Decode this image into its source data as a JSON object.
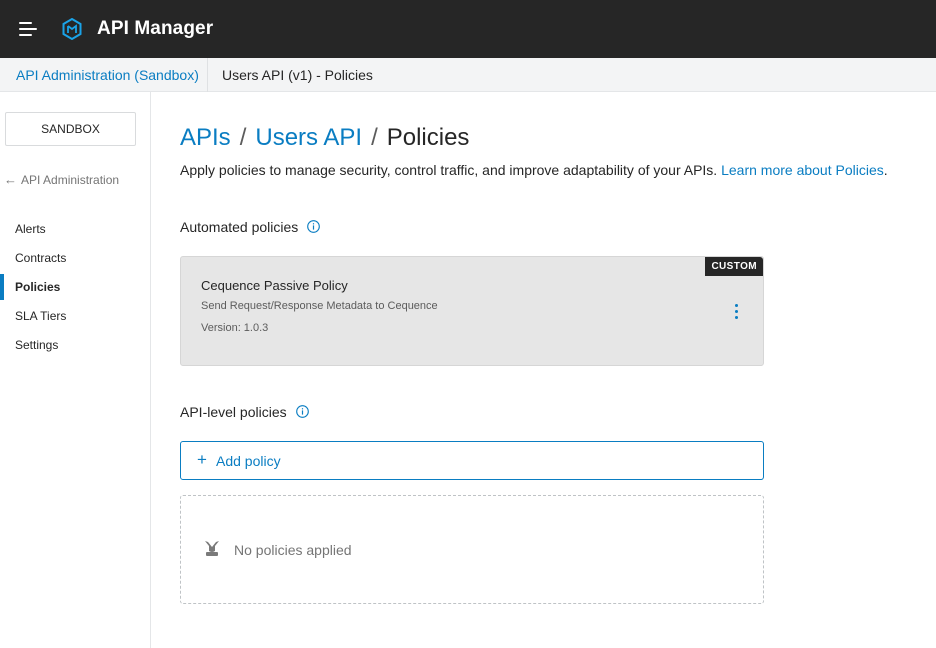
{
  "header": {
    "app_title": "API Manager",
    "menu_icon": "hamburger-menu-icon",
    "logo_icon": "api-manager-logo-icon"
  },
  "breadcrumb": {
    "parent": "API Administration (Sandbox)",
    "current": "Users API (v1) - Policies"
  },
  "sidebar": {
    "environment": "SANDBOX",
    "back_arrow": "←",
    "back_label": "API Administration",
    "items": [
      {
        "label": "Alerts",
        "active": false
      },
      {
        "label": "Contracts",
        "active": false
      },
      {
        "label": "Policies",
        "active": true
      },
      {
        "label": "SLA Tiers",
        "active": false
      },
      {
        "label": "Settings",
        "active": false
      }
    ]
  },
  "main": {
    "title": {
      "apis": "APIs",
      "sep": "/",
      "api_name": "Users API",
      "page": "Policies"
    },
    "intro_text": "Apply policies to manage security, control traffic, and improve adaptability of your APIs.",
    "intro_link": "Learn more about Policies",
    "intro_period": ".",
    "automated": {
      "title": "Automated policies",
      "policy": {
        "badge": "CUSTOM",
        "name": "Cequence Passive Policy",
        "description": "Send Request/Response Metadata to Cequence",
        "version": "Version: 1.0.3"
      }
    },
    "api_level": {
      "title": "API-level policies",
      "add_plus": "+",
      "add_label": "Add policy",
      "empty_text": "No policies applied",
      "empty_icon": "no-policies-icon"
    }
  },
  "colors": {
    "topbar": "#262626",
    "link": "#0a7dc2",
    "card_bg": "#e6e6e6"
  }
}
